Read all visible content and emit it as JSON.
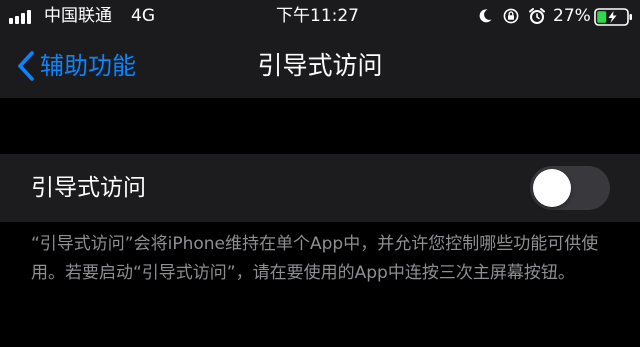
{
  "status_bar": {
    "carrier": "中国联通",
    "network": "4G",
    "time": "下午11:27",
    "battery_percent": "27%",
    "signal_bars": 4,
    "icons": [
      "signal-icon",
      "moon-icon",
      "rotation-lock-icon",
      "alarm-icon",
      "battery-charging-icon"
    ]
  },
  "nav": {
    "back_label": "辅助功能",
    "title": "引导式访问"
  },
  "setting": {
    "label": "引导式访问",
    "toggle_on": false
  },
  "footer": {
    "description": "“引导式访问”会将iPhone维持在单个App中，并允许您控制哪些功能可供使用。若要启动“引导式访问”，请在要使用的App中连按三次主屏幕按钮。"
  },
  "colors": {
    "background": "#000000",
    "bar_background": "#1b1b1d",
    "cell_background": "#1c1c1e",
    "accent": "#0a84ff",
    "secondary_text": "#8e8e93",
    "toggle_off": "#39393d",
    "battery_charging": "#32d74b"
  }
}
